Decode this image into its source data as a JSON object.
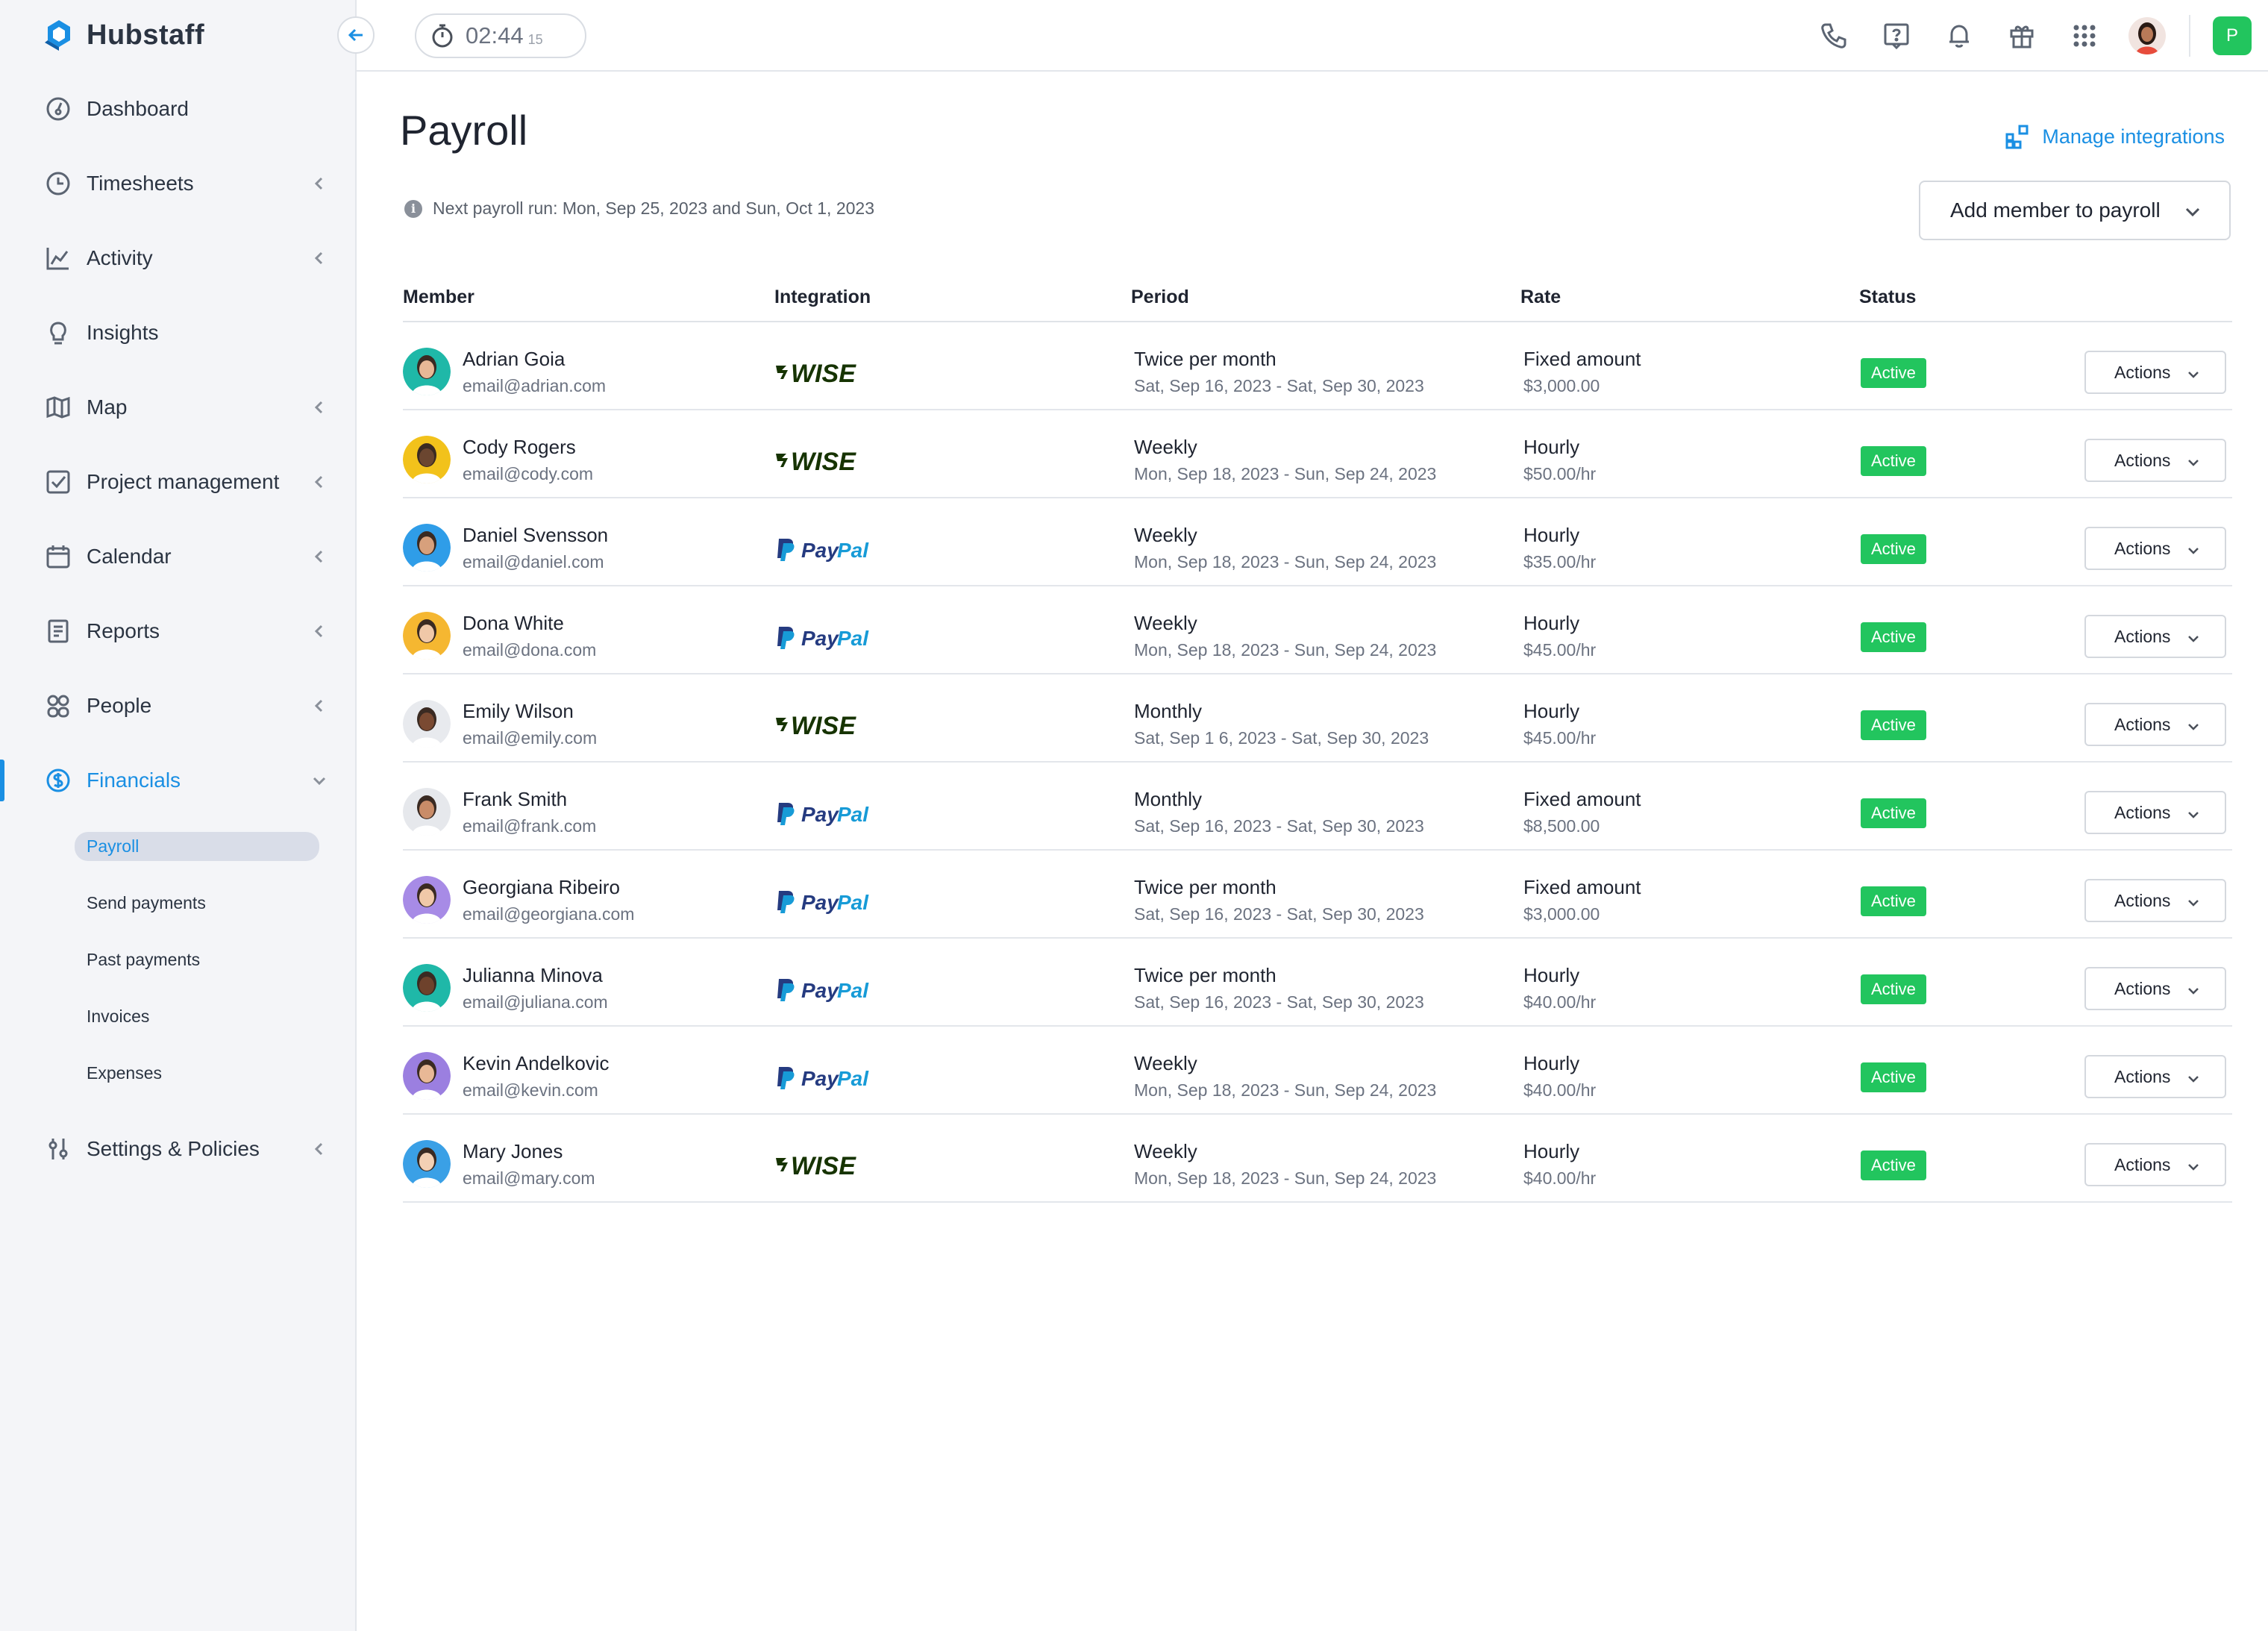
{
  "brand": {
    "name": "Hubstaff",
    "accent": "#1a8fe3",
    "active_green": "#22c55e"
  },
  "sidebar": {
    "items": [
      {
        "label": "Dashboard",
        "icon": "dashboard-icon",
        "has_chevron": false
      },
      {
        "label": "Timesheets",
        "icon": "clock-icon",
        "has_chevron": true
      },
      {
        "label": "Activity",
        "icon": "activity-chart-icon",
        "has_chevron": true
      },
      {
        "label": "Insights",
        "icon": "lightbulb-icon",
        "has_chevron": false
      },
      {
        "label": "Map",
        "icon": "map-icon",
        "has_chevron": true
      },
      {
        "label": "Project management",
        "icon": "checkbox-icon",
        "has_chevron": true
      },
      {
        "label": "Calendar",
        "icon": "calendar-icon",
        "has_chevron": true
      },
      {
        "label": "Reports",
        "icon": "report-icon",
        "has_chevron": true
      },
      {
        "label": "People",
        "icon": "people-icon",
        "has_chevron": true
      },
      {
        "label": "Financials",
        "icon": "dollar-circle-icon",
        "expanded": true
      },
      {
        "label": "Settings & Policies",
        "icon": "sliders-icon",
        "has_chevron": true
      }
    ],
    "financials_sub": [
      "Payroll",
      "Send payments",
      "Past payments",
      "Invoices",
      "Expenses"
    ],
    "current_sub": "Payroll"
  },
  "topbar": {
    "timer": {
      "time": "02:44",
      "seconds": "15"
    },
    "icons": [
      "phone-icon",
      "help-icon",
      "bell-icon",
      "gift-icon",
      "apps-grid-icon",
      "user-avatar",
      "org-badge"
    ],
    "org_initial": "P"
  },
  "main": {
    "title": "Payroll",
    "manage_label": "Manage integrations",
    "next_run": "Next payroll run: Mon, Sep 25, 2023 and Sun, Oct 1, 2023",
    "add_button": "Add member to payroll"
  },
  "table": {
    "headers": [
      "Member",
      "Integration",
      "Period",
      "Rate",
      "Status"
    ],
    "rows": [
      {
        "name": "Adrian Goia",
        "email": "email@adrian.com",
        "integration": "wise",
        "period": "Twice per month",
        "range": "Sat, Sep 16, 2023 - Sat, Sep 30, 2023",
        "rate_type": "Fixed amount",
        "rate": "$3,000.00",
        "status": "Active",
        "action": "Actions",
        "avatar_bg": "#1fb8a8",
        "skin": "#e8b896"
      },
      {
        "name": "Cody Rogers",
        "email": "email@cody.com",
        "integration": "wise",
        "period": "Weekly",
        "range": "Mon, Sep 18, 2023 - Sun, Sep 24, 2023",
        "rate_type": "Hourly",
        "rate": "$50.00/hr",
        "status": "Active",
        "action": "Actions",
        "avatar_bg": "#f2c21b",
        "skin": "#6b4630"
      },
      {
        "name": "Daniel Svensson",
        "email": "email@daniel.com",
        "integration": "paypal",
        "period": "Weekly",
        "range": "Mon, Sep 18, 2023 - Sun, Sep 24, 2023",
        "rate_type": "Hourly",
        "rate": "$35.00/hr",
        "status": "Active",
        "action": "Actions",
        "avatar_bg": "#2f9de8",
        "skin": "#d7a07c"
      },
      {
        "name": "Dona White",
        "email": "email@dona.com",
        "integration": "paypal",
        "period": "Weekly",
        "range": "Mon, Sep 18, 2023 - Sun, Sep 24, 2023",
        "rate_type": "Hourly",
        "rate": "$45.00/hr",
        "status": "Active",
        "action": "Actions",
        "avatar_bg": "#f5b731",
        "skin": "#f0c8a8"
      },
      {
        "name": "Emily Wilson",
        "email": "email@emily.com",
        "integration": "wise",
        "period": "Monthly",
        "range": "Sat, Sep 1  6, 2023 - Sat, Sep 30, 2023",
        "rate_type": "Hourly",
        "rate": "$45.00/hr",
        "status": "Active",
        "action": "Actions",
        "avatar_bg": "#e8eaee",
        "skin": "#7a4a32"
      },
      {
        "name": "Frank Smith",
        "email": "email@frank.com",
        "integration": "paypal",
        "period": "Monthly",
        "range": "Sat, Sep 16, 2023 - Sat, Sep 30, 2023",
        "rate_type": "Fixed amount",
        "rate": "$8,500.00",
        "status": "Active",
        "action": "Actions",
        "avatar_bg": "#e6e8ec",
        "skin": "#c98c68"
      },
      {
        "name": "Georgiana Ribeiro",
        "email": "email@georgiana.com",
        "integration": "paypal",
        "period": "Twice per month",
        "range": "Sat, Sep 16, 2023 - Sat, Sep 30, 2023",
        "rate_type": "Fixed amount",
        "rate": "$3,000.00",
        "status": "Active",
        "action": "Actions",
        "avatar_bg": "#a78be6",
        "skin": "#f0c8a8"
      },
      {
        "name": "Julianna Minova",
        "email": "email@juliana.com",
        "integration": "paypal",
        "period": "Twice per month",
        "range": "Sat, Sep 16, 2023 - Sat, Sep 30, 2023",
        "rate_type": "Hourly",
        "rate": "$40.00/hr",
        "status": "Active",
        "action": "Actions",
        "avatar_bg": "#1fb8a8",
        "skin": "#6e422c"
      },
      {
        "name": "Kevin Andelkovic",
        "email": "email@kevin.com",
        "integration": "paypal",
        "period": "Weekly",
        "range": "Mon, Sep 18, 2023 - Sun, Sep 24, 2023",
        "rate_type": "Hourly",
        "rate": "$40.00/hr",
        "status": "Active",
        "action": "Actions",
        "avatar_bg": "#9b7fe0",
        "skin": "#e8b896"
      },
      {
        "name": "Mary Jones",
        "email": "email@mary.com",
        "integration": "wise",
        "period": "Weekly",
        "range": "Mon, Sep 18, 2023 - Sun, Sep 24, 2023",
        "rate_type": "Hourly",
        "rate": "$40.00/hr",
        "status": "Active",
        "action": "Actions",
        "avatar_bg": "#3aa0e6",
        "skin": "#f3d0b4"
      }
    ]
  }
}
